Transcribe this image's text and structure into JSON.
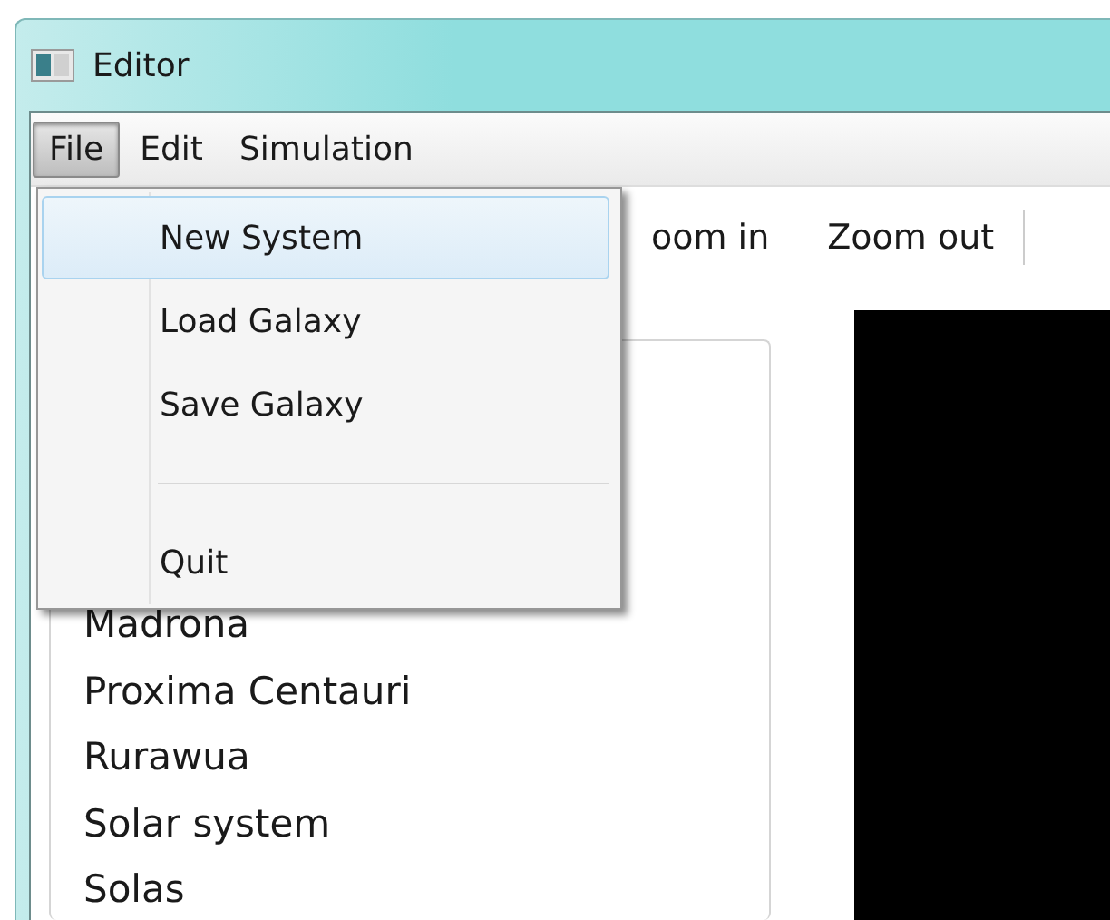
{
  "window": {
    "title": "Editor"
  },
  "menu_bar": [
    {
      "label": "File",
      "selected": true
    },
    {
      "label": "Edit",
      "selected": false
    },
    {
      "label": "Simulation",
      "selected": false
    }
  ],
  "file_menu": {
    "items": [
      {
        "kind": "item",
        "label": "New System",
        "selected": true
      },
      {
        "kind": "item",
        "label": "Load Galaxy",
        "selected": false
      },
      {
        "kind": "item",
        "label": "Save Galaxy",
        "selected": false
      },
      {
        "kind": "separator"
      },
      {
        "kind": "item",
        "label": "Quit",
        "selected": false
      }
    ]
  },
  "toolbar": {
    "buttons": [
      "oom in",
      "Zoom out"
    ]
  },
  "system_list": {
    "items": [
      "Madrona",
      "Proxima Centauri",
      "Rurawua",
      "Solar system",
      "Solas"
    ]
  }
}
